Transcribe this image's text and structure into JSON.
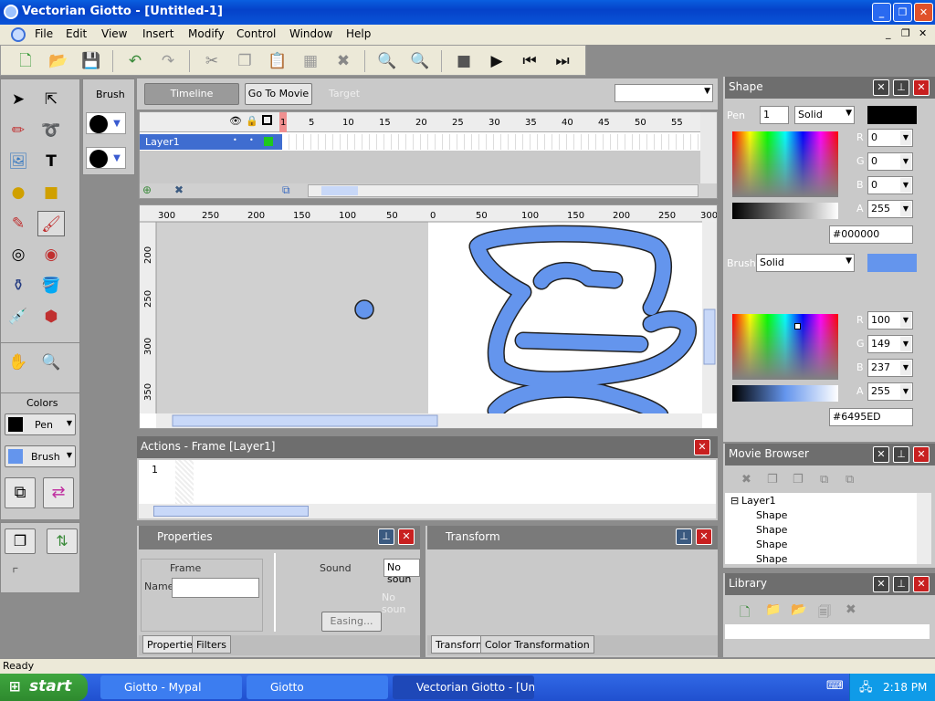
{
  "window": {
    "title": "Vectorian Giotto - [Untitled-1]",
    "min": "_",
    "max": "❐",
    "close": "✕"
  },
  "menu": {
    "items": [
      "File",
      "Edit",
      "View",
      "Insert",
      "Modify",
      "Control",
      "Window",
      "Help"
    ],
    "mdi_min": "_",
    "mdi_restore": "❐",
    "mdi_close": "✕"
  },
  "toolbar": {
    "icons": [
      "new-file",
      "open-folder",
      "save",
      "undo",
      "redo",
      "cut",
      "copy",
      "paste",
      "paste-special",
      "delete",
      "zoom-in",
      "zoom-out",
      "stop",
      "play",
      "rewind",
      "step-forward"
    ]
  },
  "brush_panel": {
    "title": "Brush"
  },
  "colors_panel": {
    "title": "Colors",
    "pen_label": "Pen",
    "brush_label": "Brush"
  },
  "timeline_header": {
    "timeline_btn": "Timeline",
    "gotomovie_btn": "Go To Movie",
    "target_label": "Target"
  },
  "timeline": {
    "frame_numbers": [
      "1",
      "5",
      "10",
      "15",
      "20",
      "25",
      "30",
      "35",
      "40",
      "45",
      "50",
      "55"
    ],
    "layer_name": "Layer1"
  },
  "stage": {
    "hruler": [
      "300",
      "250",
      "200",
      "150",
      "100",
      "50",
      "0",
      "50",
      "100",
      "150",
      "200",
      "250",
      "300"
    ],
    "vruler": [
      "200",
      "250",
      "300",
      "350"
    ],
    "fill_color": "#6495ED"
  },
  "actions": {
    "title": "Actions - Frame [Layer1]",
    "line_number": "1"
  },
  "properties": {
    "title": "Properties",
    "frame_label": "Frame",
    "name_label": "Name",
    "sound_label": "Sound",
    "sound_select": "No soun",
    "sound_text": "No soun",
    "easing_btn": "Easing...",
    "tabs": [
      "Properties",
      "Filters"
    ]
  },
  "transform": {
    "title": "Transform",
    "tabs": [
      "Transform",
      "Color Transformation"
    ]
  },
  "shape": {
    "title": "Shape",
    "pen_label": "Pen",
    "pen_width": "1",
    "pen_style": "Solid",
    "pen_r": "0",
    "pen_g": "0",
    "pen_b": "0",
    "pen_a": "255",
    "pen_hex": "#000000",
    "brush_label": "Brush",
    "brush_style": "Solid",
    "brush_r": "100",
    "brush_g": "149",
    "brush_b": "237",
    "brush_a": "255",
    "brush_hex": "#6495ED",
    "r": "R",
    "g": "G",
    "b": "B",
    "a": "A"
  },
  "movie_browser": {
    "title": "Movie Browser",
    "root": "Layer1",
    "children": [
      "Shape",
      "Shape",
      "Shape",
      "Shape"
    ]
  },
  "library": {
    "title": "Library"
  },
  "status": {
    "text": "Ready"
  },
  "taskbar": {
    "start": "start",
    "tasks": [
      "Giotto - Mypal",
      "Giotto",
      "Vectorian Giotto - [Un..."
    ],
    "clock": "2:18 PM"
  }
}
